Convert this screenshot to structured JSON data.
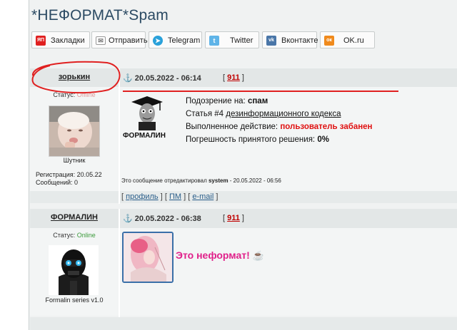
{
  "page_title": "*НЕФОРМАТ*Spam",
  "share_buttons": [
    {
      "label": "Закладки",
      "icon": "yandex-icon",
      "color": "#e02020",
      "icon_text": "ЯП"
    },
    {
      "label": "Отправить",
      "icon": "mail-icon",
      "color": "#8a8a8a",
      "icon_text": "✉"
    },
    {
      "label": "Telegram",
      "icon": "telegram-icon",
      "color": "#2aa1da",
      "icon_text": "➤"
    },
    {
      "label": "Twitter",
      "icon": "twitter-icon",
      "color": "#5fb4e8",
      "icon_text": "t"
    },
    {
      "label": "Вконтакте",
      "icon": "vk-icon",
      "color": "#4a76a8",
      "icon_text": "vk"
    },
    {
      "label": "OK.ru",
      "icon": "ok-icon",
      "color": "#f08a1c",
      "icon_text": "ок"
    }
  ],
  "post1": {
    "username": "зорькин",
    "status_label": "Статус:",
    "status_value": "Offline",
    "avatar_caption": "Шутник",
    "registration": "Регистрация: 20.05.22",
    "messages": "Сообщений: 0",
    "date": "20.05.2022 - 06:14",
    "number": "911",
    "moderator_name": "ФОРМАЛИН",
    "suspicion_label": "Подозрение на:",
    "suspicion_value": "спам",
    "article_prefix": "Статья #4",
    "article_link": "дезинформационного кодекса",
    "action_label": "Выполненное действие:",
    "action_value": "пользователь забанен",
    "error_label": "Погрешность принятого решения:",
    "error_value": "0%",
    "edited_prefix": "Это сообщение отредактировал",
    "edited_by": "system",
    "edited_time": "- 20.05.2022 - 06:56",
    "links": {
      "profile": "профиль",
      "pm": "ПМ",
      "email": "e-mail"
    }
  },
  "post2": {
    "username": "ФОРМАЛИН",
    "status_label": "Статус:",
    "status_value": "Online",
    "avatar_caption": "Formalin series v1.0",
    "date": "20.05.2022 - 06:38",
    "number": "911",
    "message": "Это неформат!"
  }
}
